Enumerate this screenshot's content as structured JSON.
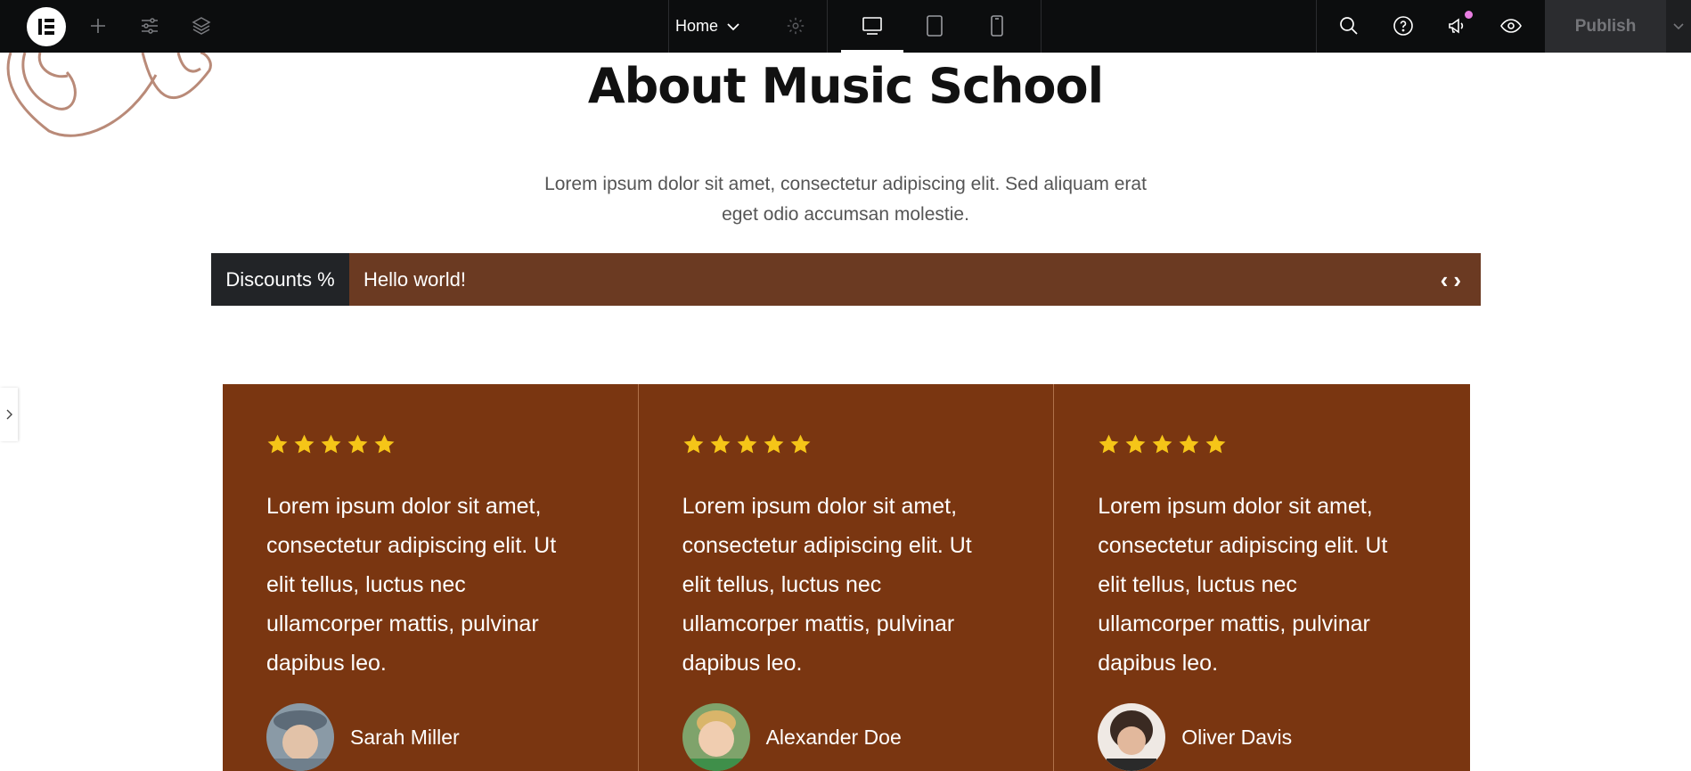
{
  "topbar": {
    "page_name": "Home",
    "publish_label": "Publish"
  },
  "content": {
    "title": "About Music School",
    "intro": "Lorem ipsum dolor sit amet, consectetur adipiscing elit. Sed aliquam erat eget odio accumsan molestie.",
    "ticker": {
      "label": "Discounts %",
      "text": "Hello world!",
      "prev": "‹",
      "next": "›"
    },
    "testimonials": [
      {
        "rating": 5,
        "quote": "Lorem ipsum dolor sit amet, consectetur adipiscing elit. Ut elit tellus, luctus nec ullamcorper mattis, pulvinar dapibus leo.",
        "name": "Sarah Miller"
      },
      {
        "rating": 5,
        "quote": "Lorem ipsum dolor sit amet, consectetur adipiscing elit. Ut elit tellus, luctus nec ullamcorper mattis, pulvinar dapibus leo.",
        "name": "Alexander Doe"
      },
      {
        "rating": 5,
        "quote": "Lorem ipsum dolor sit amet, consectetur adipiscing elit. Ut elit tellus, luctus nec ullamcorper mattis, pulvinar dapibus leo.",
        "name": "Oliver Davis"
      }
    ]
  },
  "colors": {
    "topbar_bg": "#0c0d0e",
    "ticker_bg": "#6b3a22",
    "ticker_label_bg": "#222427",
    "testimonial_bg": "#7a3611",
    "star": "#f5c518",
    "notification_dot": "#e87de1"
  },
  "icons": [
    "elementor-logo-icon",
    "add-icon",
    "site-settings-icon",
    "structure-layers-icon",
    "chevron-down-icon",
    "page-settings-gear-icon",
    "desktop-icon",
    "tablet-icon",
    "mobile-icon",
    "search-icon",
    "help-icon",
    "whats-new-megaphone-icon",
    "preview-eye-icon",
    "star-icon"
  ]
}
